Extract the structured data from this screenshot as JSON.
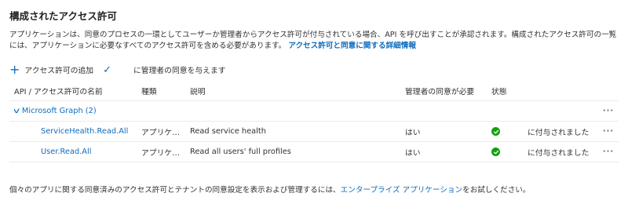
{
  "page": {
    "title": "構成されたアクセス許可",
    "description": "アプリケーションは、同意のプロセスの一環としてユーザーか管理者からアクセス許可が付与されている場合、API を呼び出すことが承認されます。構成されたアクセス許可の一覧には、アプリケーションに必要なすべてのアクセス許可を含める必要があります。",
    "description_link": "アクセス許可と同意に関する詳細情報"
  },
  "toolbar": {
    "add_label": "アクセス許可の追加",
    "grant_label": "に管理者の同意を与えます"
  },
  "table": {
    "headers": {
      "name": "API / アクセス許可の名前",
      "type": "種類",
      "description": "説明",
      "admin_consent": "管理者の同意が必要",
      "status": "状態"
    },
    "group": {
      "label": "Microsoft Graph (2)",
      "more": "···"
    },
    "rows": [
      {
        "name": "ServiceHealth.Read.All",
        "type": "アプリケーション",
        "description": "Read service health",
        "admin_consent": "はい",
        "status_icon": "success-check-icon",
        "granted": "に付与されました",
        "more": "···"
      },
      {
        "name": "User.Read.All",
        "type": "アプリケーション",
        "description": "Read all users' full profiles",
        "admin_consent": "はい",
        "status_icon": "success-check-icon",
        "granted": "に付与されました",
        "more": "···"
      }
    ]
  },
  "footer": {
    "text_before": "個々のアプリに関する同意済みのアクセス許可とテナントの同意設定を表示および管理するには、",
    "link": "エンタープライズ アプリケーション",
    "text_after": "をお試しください。"
  },
  "colors": {
    "accent": "#0f6cbd",
    "success": "#13a10e",
    "divider": "#edebe9"
  }
}
